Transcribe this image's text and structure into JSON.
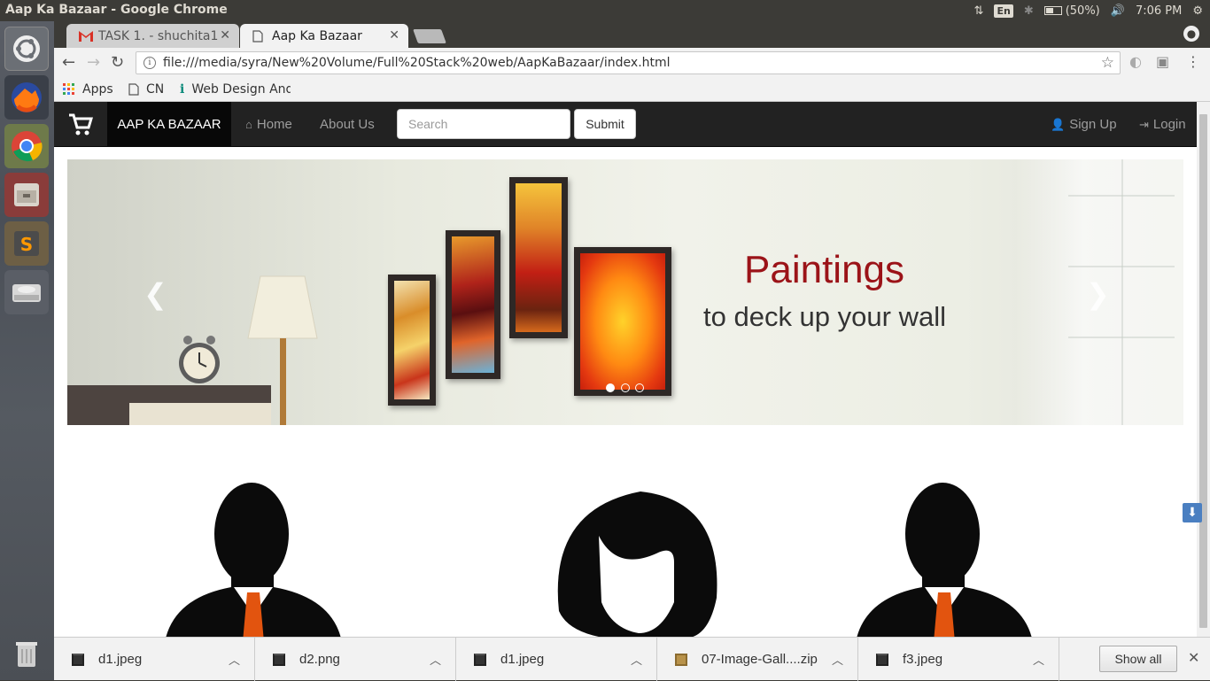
{
  "os": {
    "window_title": "Aap Ka Bazaar - Google Chrome",
    "battery": "(50%)",
    "time": "7:06 PM",
    "keyboard_layout": "En"
  },
  "launcher": {
    "items": [
      "ubuntu-dash-icon",
      "firefox-icon",
      "chrome-icon",
      "files-icon",
      "sublime-text-icon",
      "drive-icon",
      "trash-icon"
    ]
  },
  "browser": {
    "tabs": [
      {
        "title": "TASK 1. - shuchita1",
        "icon": "gmail-icon"
      },
      {
        "title": "Aap Ka Bazaar",
        "icon": "page-icon"
      }
    ],
    "url": "file:///media/syra/New%20Volume/Full%20Stack%20web/AapKaBazaar/index.html",
    "bookmarks": [
      {
        "label": "Apps",
        "icon": "apps-grid-icon"
      },
      {
        "label": "CN",
        "icon": "page-icon"
      },
      {
        "label": "Web Design And",
        "icon": "info-icon"
      }
    ]
  },
  "site": {
    "brand": "AAP KA BAZAAR",
    "nav": {
      "home": "Home",
      "about": "About Us"
    },
    "search_placeholder": "Search",
    "submit_label": "Submit",
    "signup": "Sign Up",
    "login": "Login",
    "carousel": {
      "headline": "Paintings",
      "subline": "to deck up your wall",
      "slide_count": 3,
      "active_slide": 1
    }
  },
  "downloads": {
    "items": [
      {
        "name": "d1.jpeg",
        "icon": "image-file-icon"
      },
      {
        "name": "d2.png",
        "icon": "image-file-icon"
      },
      {
        "name": "d1.jpeg",
        "icon": "image-file-icon"
      },
      {
        "name": "07-Image-Gall....zip",
        "icon": "archive-file-icon"
      },
      {
        "name": "f3.jpeg",
        "icon": "image-file-icon"
      }
    ],
    "show_all": "Show all"
  },
  "colors": {
    "navbar": "#222222",
    "brand_bg": "#080808",
    "headline": "#9b1318",
    "os_panel": "#3c3b37"
  }
}
